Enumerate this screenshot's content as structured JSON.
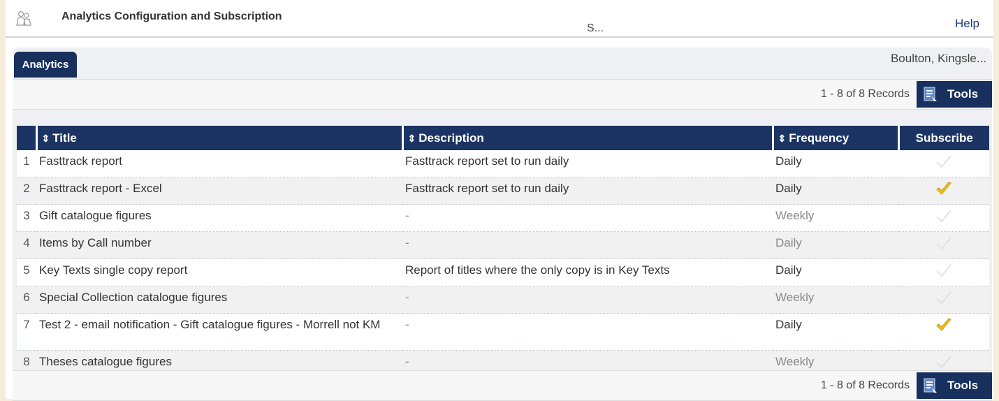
{
  "header": {
    "title": "Analytics Configuration and Subscription",
    "subtitle": "S...",
    "help": "Help"
  },
  "tabs": {
    "active": "Analytics"
  },
  "user": {
    "name": "Boulton, Kingsle..."
  },
  "toolbar": {
    "records": "1 - 8 of 8 Records",
    "tools": "Tools"
  },
  "table": {
    "columns": [
      "Title",
      "Description",
      "Frequency",
      "Subscribe"
    ],
    "rows": [
      {
        "num": "1",
        "title": "Fasttrack report",
        "description": "Fasttrack report set to run daily",
        "frequency": "Daily",
        "subscribed": false
      },
      {
        "num": "2",
        "title": "Fasttrack report - Excel",
        "description": "Fasttrack report set to run daily",
        "frequency": "Daily",
        "subscribed": true
      },
      {
        "num": "3",
        "title": "Gift catalogue figures",
        "description": "-",
        "frequency": "Weekly",
        "subscribed": false
      },
      {
        "num": "4",
        "title": "Items by Call number",
        "description": "-",
        "frequency": "Daily",
        "subscribed": false
      },
      {
        "num": "5",
        "title": "Key Texts single copy report",
        "description": "Report of titles where the only copy is in Key Texts",
        "frequency": "Daily",
        "subscribed": false
      },
      {
        "num": "6",
        "title": "Special Collection catalogue figures",
        "description": "-",
        "frequency": "Weekly",
        "subscribed": false
      },
      {
        "num": "7",
        "title": "Test 2 - email notification - Gift catalogue figures - Morrell not KM",
        "description": "-",
        "frequency": "Daily",
        "subscribed": true
      },
      {
        "num": "8",
        "title": "Theses catalogue figures",
        "description": "-",
        "frequency": "Weekly",
        "subscribed": false
      }
    ]
  },
  "colors": {
    "nav": "#17305e",
    "subscribed": "#f0c419",
    "unsubscribed": "#dcdcdc"
  }
}
